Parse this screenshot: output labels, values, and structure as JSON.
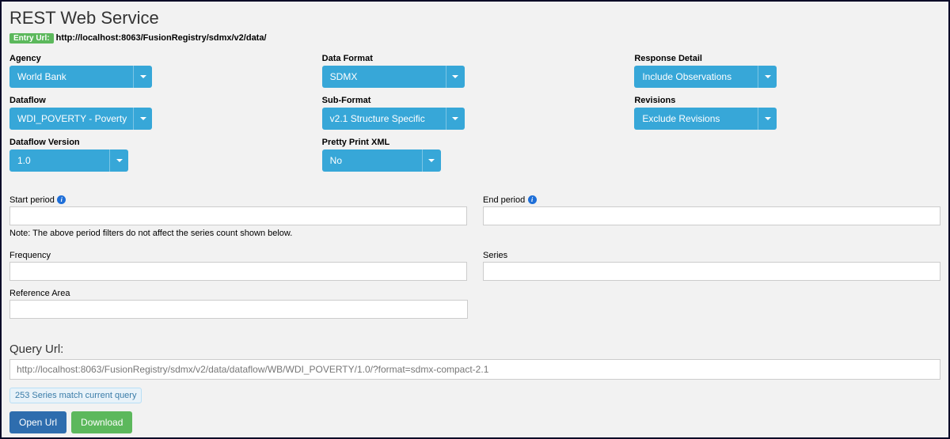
{
  "header": {
    "title": "REST Web Service",
    "entry_badge": "Entry Url:",
    "entry_url": "http://localhost:8063/FusionRegistry/sdmx/v2/data/"
  },
  "cols": {
    "left": {
      "agency": {
        "label": "Agency",
        "value": "World Bank"
      },
      "dataflow": {
        "label": "Dataflow",
        "value": "WDI_POVERTY - Poverty"
      },
      "version": {
        "label": "Dataflow Version",
        "value": "1.0"
      }
    },
    "mid": {
      "format": {
        "label": "Data Format",
        "value": "SDMX"
      },
      "subformat": {
        "label": "Sub-Format",
        "value": "v2.1 Structure Specific"
      },
      "pretty": {
        "label": "Pretty Print XML",
        "value": "No"
      }
    },
    "right": {
      "detail": {
        "label": "Response Detail",
        "value": "Include Observations"
      },
      "revisions": {
        "label": "Revisions",
        "value": "Exclude Revisions"
      }
    }
  },
  "periods": {
    "start_label": "Start period",
    "end_label": "End period",
    "note": "Note: The above period filters do not affect the series count shown below."
  },
  "filters": {
    "frequency": "Frequency",
    "series": "Series",
    "ref_area": "Reference Area"
  },
  "query": {
    "label": "Query Url:",
    "value": "http://localhost:8063/FusionRegistry/sdmx/v2/data/dataflow/WB/WDI_POVERTY/1.0/?format=sdmx-compact-2.1"
  },
  "badge": "253 Series match current query",
  "actions": {
    "open": "Open Url",
    "download": "Download"
  }
}
